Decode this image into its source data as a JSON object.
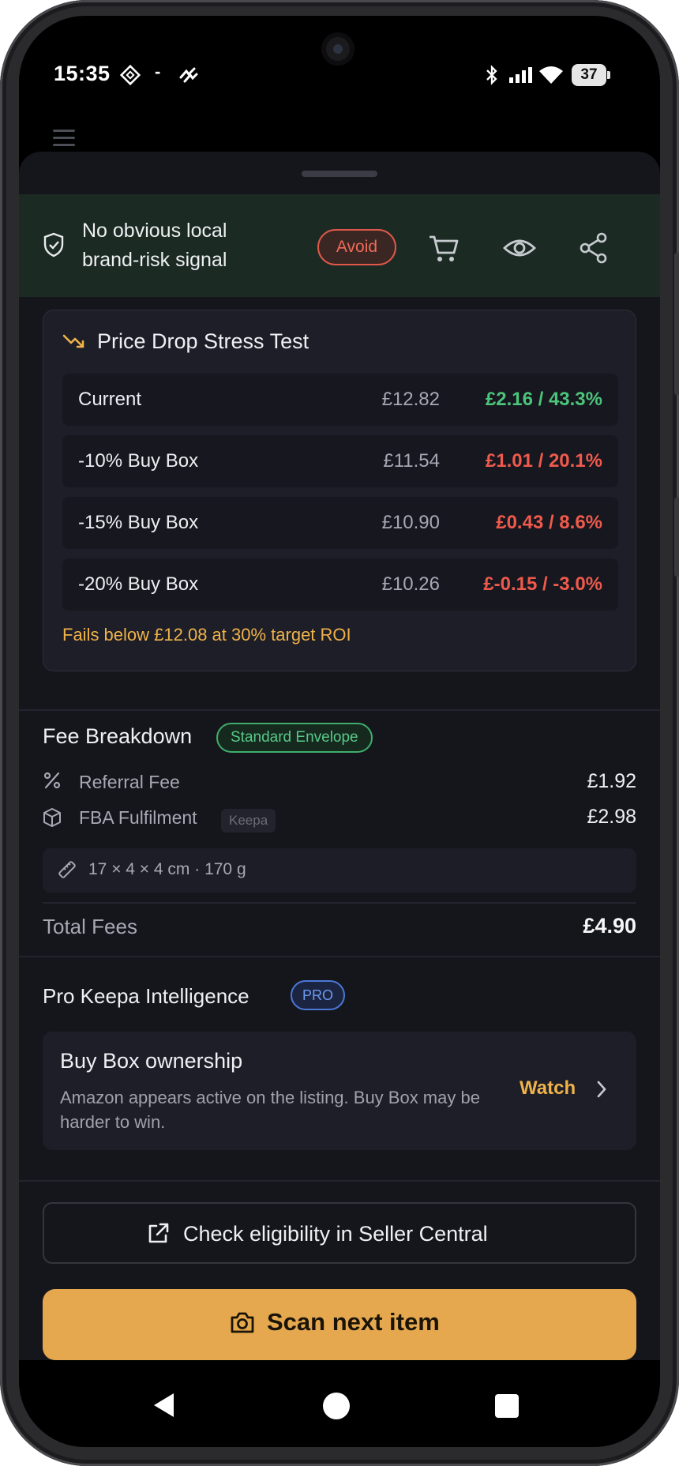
{
  "status_bar": {
    "time": "15:35",
    "separator": "-",
    "battery": "37"
  },
  "banner": {
    "message": "No obvious local brand-risk signal",
    "verdict": "Avoid"
  },
  "stress_test": {
    "title": "Price Drop Stress Test",
    "rows": [
      {
        "label": "Current",
        "price": "£12.82",
        "result": "£2.16 / 43.3%",
        "color": "#4cc47a"
      },
      {
        "label": "-10% Buy Box",
        "price": "£11.54",
        "result": "£1.01 / 20.1%",
        "color": "#ef5a4c"
      },
      {
        "label": "-15% Buy Box",
        "price": "£10.90",
        "result": "£0.43 / 8.6%",
        "color": "#ef5a4c"
      },
      {
        "label": "-20% Buy Box",
        "price": "£10.26",
        "result": "£-0.15 / -3.0%",
        "color": "#ef5a4c"
      }
    ],
    "note": "Fails below £12.08 at 30% target ROI"
  },
  "fees": {
    "title": "Fee Breakdown",
    "badge": "Standard Envelope",
    "referral_label": "Referral Fee",
    "referral_value": "£1.92",
    "fba_label": "FBA Fulfilment",
    "fba_tag": "Keepa",
    "fba_value": "£2.98",
    "dimensions": "17 × 4 × 4 cm · 170 g",
    "total_label": "Total Fees",
    "total_value": "£4.90"
  },
  "pro": {
    "title": "Pro Keepa Intelligence",
    "badge": "PRO",
    "card_title": "Buy Box ownership",
    "card_desc": "Amazon appears active on the listing. Buy Box may be harder to win.",
    "card_action": "Watch"
  },
  "buttons": {
    "eligibility": "Check eligibility in Seller Central",
    "scan": "Scan next item"
  },
  "colors": {
    "accent": "#e6a84e",
    "danger": "#ef5a4c",
    "success": "#4cc47a",
    "pro": "#6d9bf2"
  },
  "icons": [
    "menu-icon",
    "shield-check-icon",
    "cart-icon",
    "eye-icon",
    "share-icon",
    "trend-down-icon",
    "percent-icon",
    "box-icon",
    "ruler-icon",
    "chevron-right-icon",
    "external-link-icon",
    "camera-icon",
    "back-icon",
    "home-icon",
    "recents-icon"
  ]
}
